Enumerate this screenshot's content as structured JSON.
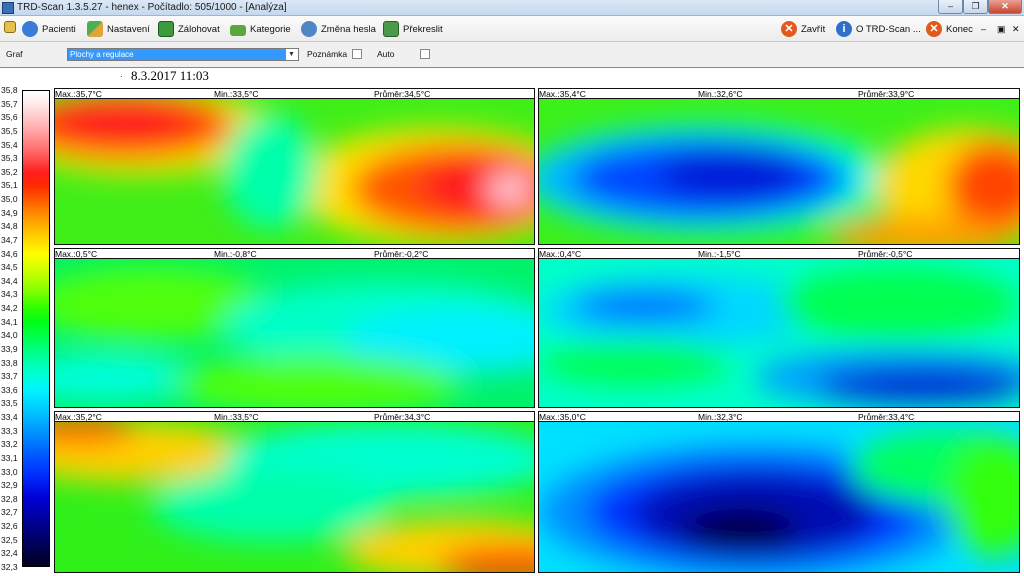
{
  "window": {
    "title": "TRD-Scan 1.3.5.27  - henex - Počítadlo: 505/1000 - [Analýza]",
    "controls": [
      "–",
      "❐",
      "✕"
    ]
  },
  "toolbar": {
    "pacienti": "Pacienti",
    "nastaveni": "Nastavení",
    "zalohovat": "Zálohovat",
    "kategorie": "Kategorie",
    "zmena_hesla": "Změna hesla",
    "prekreslit": "Překreslit",
    "zavrit": "Zavřít",
    "o_trd_scan": "O TRD-Scan ...",
    "konec": "Konec",
    "mdi_controls": [
      "–",
      "▣",
      "✕"
    ]
  },
  "graph_bar": {
    "label": "Graf",
    "selected": "Plochy a regulace",
    "poznamka_label": "Poznámka",
    "auto_label": "Auto"
  },
  "datetime": "8.3.2017 11:03",
  "legend": {
    "labels": [
      "35,8",
      "35,7",
      "35,6",
      "35,5",
      "35,4",
      "35,3",
      "35,2",
      "35,1",
      "35,0",
      "34,9",
      "34,8",
      "34,7",
      "34,6",
      "34,5",
      "34,4",
      "34,3",
      "34,2",
      "34,1",
      "34,0",
      "33,9",
      "33,8",
      "33,7",
      "33,6",
      "33,5",
      "33,4",
      "33,3",
      "33,2",
      "33,1",
      "33,0",
      "32,9",
      "32,8",
      "32,7",
      "32,6",
      "32,5",
      "32,4",
      "32,3"
    ],
    "colors": [
      "#ffffff",
      "#ffe8e8",
      "#ffc6c6",
      "#ffa2a2",
      "#ff7b7b",
      "#ff4e4e",
      "#ff1f1f",
      "#ff2a00",
      "#ff5a00",
      "#ff8a00",
      "#ffb400",
      "#ffd800",
      "#ffff00",
      "#d8ff00",
      "#a8ff00",
      "#70ff00",
      "#2cff00",
      "#00ff14",
      "#00ff44",
      "#00ff7c",
      "#00ffae",
      "#00ffd8",
      "#00f4ff",
      "#00d8ff",
      "#00b8ff",
      "#0098ff",
      "#0076ff",
      "#0054ff",
      "#0036ff",
      "#0018f0",
      "#0000d4",
      "#0000b0",
      "#00008c",
      "#000068",
      "#000044",
      "#000020"
    ]
  },
  "panels": [
    {
      "max": "Max.:35,7°C",
      "min": "Min.:33,5°C",
      "avg": "Průměr:34,5°C"
    },
    {
      "max": "Max.:35,4°C",
      "min": "Min.:32,6°C",
      "avg": "Průměr:33,9°C"
    },
    {
      "max": "Max.:0,5°C",
      "min": "Min.:-0,8°C",
      "avg": "Průměr:-0,2°C"
    },
    {
      "max": "Max.:0,4°C",
      "min": "Min.:-1,5°C",
      "avg": "Průměr:-0,5°C"
    },
    {
      "max": "Max.:35,2°C",
      "min": "Min.:33,5°C",
      "avg": "Průměr:34,3°C"
    },
    {
      "max": "Max.:35,0°C",
      "min": "Min.:32,3°C",
      "avg": "Průměr:33,4°C"
    }
  ]
}
